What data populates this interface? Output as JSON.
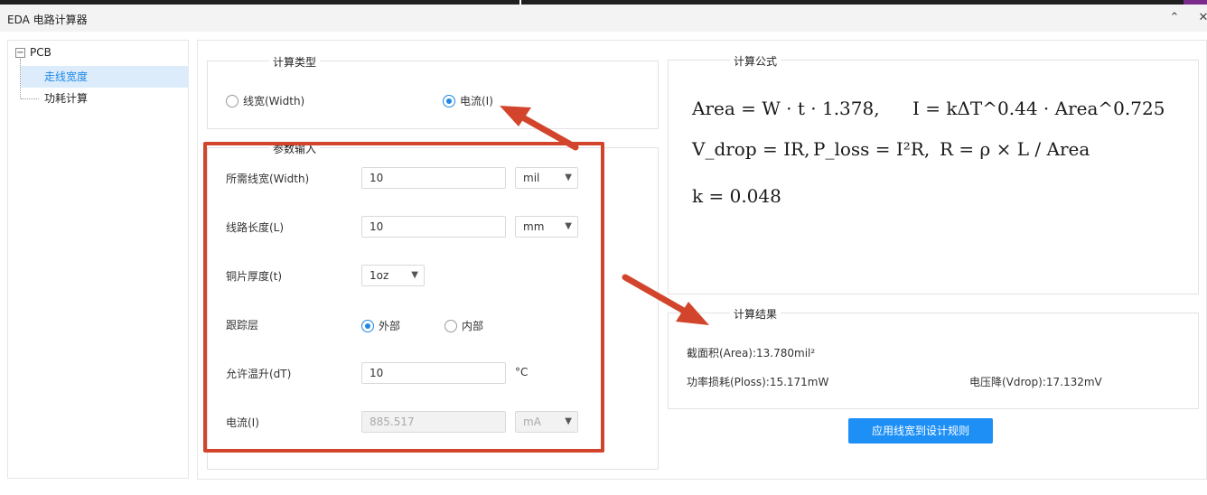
{
  "window": {
    "title": "EDA 电路计算器",
    "collapse_glyph": "⌃",
    "close_glyph": "✕"
  },
  "tree": {
    "expander_glyph": "−",
    "root": "PCB",
    "items": [
      {
        "label": "走线宽度",
        "selected": true
      },
      {
        "label": "功耗计算",
        "selected": false
      }
    ]
  },
  "calc_type": {
    "legend": "计算类型",
    "options": [
      {
        "label": "线宽(Width)",
        "checked": false
      },
      {
        "label": "电流(I)",
        "checked": true
      }
    ]
  },
  "params": {
    "legend": "参数输入",
    "width": {
      "label": "所需线宽(Width)",
      "value": "10",
      "unit": "mil"
    },
    "length": {
      "label": "线路长度(L)",
      "value": "10",
      "unit": "mm"
    },
    "thickness": {
      "label": "铜片厚度(t)",
      "value": "1oz"
    },
    "layer": {
      "label": "跟踪层",
      "options": [
        {
          "label": "外部",
          "checked": true
        },
        {
          "label": "内部",
          "checked": false
        }
      ]
    },
    "temp_rise": {
      "label": "允许温升(dT)",
      "value": "10",
      "unit": "°C"
    },
    "current": {
      "label": "电流(I)",
      "value": "885.517",
      "unit": "mA"
    }
  },
  "formula": {
    "legend": "计算公式",
    "line1a": "Area = W · t · 1.378,",
    "line1b": "I = kΔT^0.44 · Area^0.725",
    "line2a": "V_drop = IR,",
    "line2b": "P_loss = I²R,",
    "line2c": "R = ρ × L / Area",
    "line3": "k = 0.048"
  },
  "result": {
    "legend": "计算结果",
    "area": "截面积(Area):13.780mil²",
    "ploss": "功率损耗(Ploss):15.171mW",
    "vdrop": "电压降(Vdrop):17.132mV"
  },
  "apply_button": "应用线宽到设计规则",
  "colors": {
    "accent": "#1e88e5",
    "button": "#1e90f5",
    "annotation": "#d2452c"
  }
}
